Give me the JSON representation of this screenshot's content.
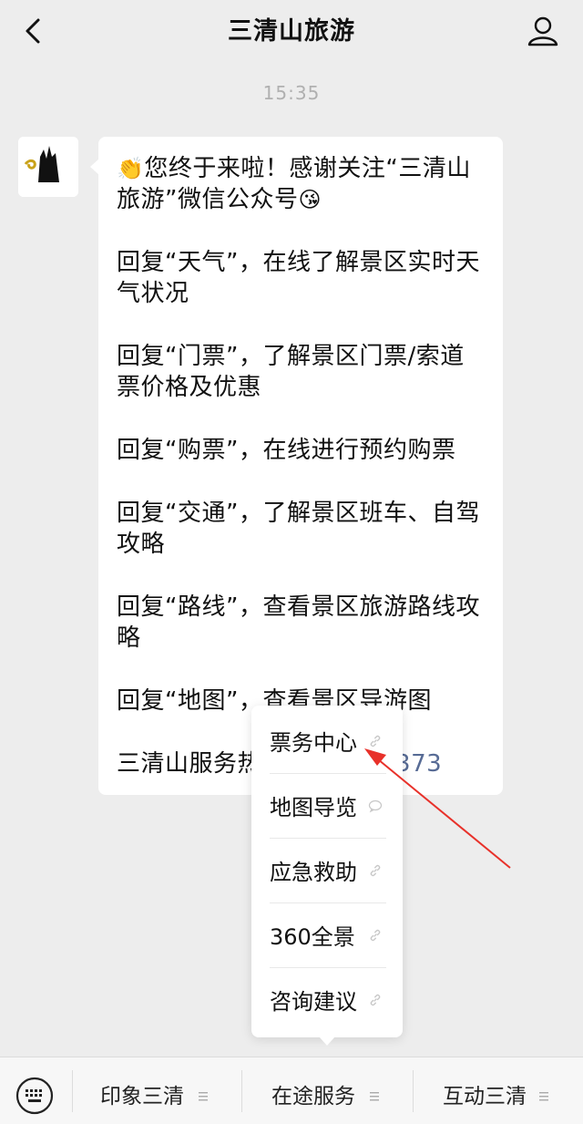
{
  "header": {
    "title": "三清山旅游"
  },
  "chat": {
    "time": "15:35",
    "avatar_logo_text": "三清山",
    "message": {
      "line1_emoji_start": "👏",
      "line1_text": "您终于来啦！感谢关注“三清山旅游”微信公众号",
      "line1_emoji_end": "😘",
      "line2": "回复“天气”，在线了解景区实时天气状况",
      "line3": "回复“门票”，了解景区门票/索道票价格及优惠",
      "line4": "回复“购票”，在线进行预约购票",
      "line5": "回复“交通”，了解景区班车、自驾攻略",
      "line6": "回复“路线”，查看景区旅游路线攻略",
      "line7": "回复“地图”，查看景区导游图",
      "hotline_prefix": "三清山服务热",
      "hotline_number": "6373"
    }
  },
  "popup_menu": {
    "items": [
      {
        "label": "票务中心",
        "icon": "link-icon"
      },
      {
        "label": "地图导览",
        "icon": "message-icon"
      },
      {
        "label": "应急救助",
        "icon": "link-icon"
      },
      {
        "label": "360全景",
        "icon": "link-icon"
      },
      {
        "label": "咨询建议",
        "icon": "link-icon"
      }
    ]
  },
  "bottom_menu": {
    "tabs": [
      {
        "label": "印象三清",
        "icon": "menu-lines-icon"
      },
      {
        "label": "在途服务",
        "icon": "menu-lines-icon"
      },
      {
        "label": "互动三清",
        "icon": "menu-lines-icon"
      }
    ]
  },
  "colors": {
    "link": "#576b95",
    "annotation_arrow": "#e8312a",
    "background": "#ededed"
  }
}
